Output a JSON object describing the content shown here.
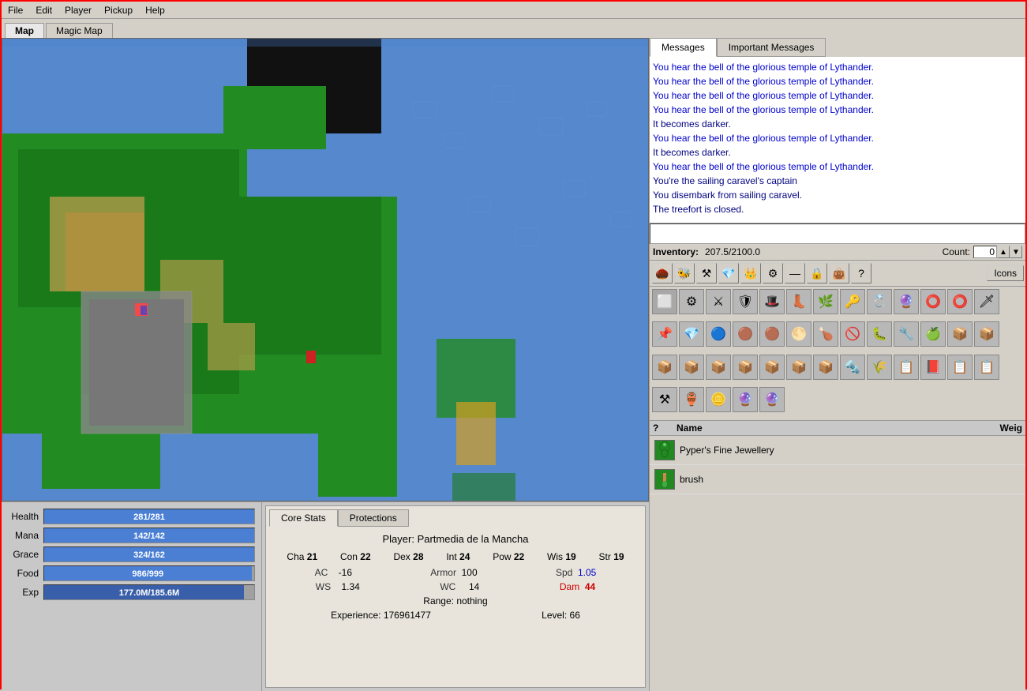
{
  "menu": {
    "items": [
      "File",
      "Edit",
      "Player",
      "Pickup",
      "Help"
    ]
  },
  "map_tabs": [
    {
      "label": "Map",
      "active": true
    },
    {
      "label": "Magic Map",
      "active": false
    }
  ],
  "messages": {
    "tabs": [
      {
        "label": "Messages",
        "active": true
      },
      {
        "label": "Important Messages",
        "active": false
      }
    ],
    "lines": [
      "You hear the bell of the glorious temple of Lythander.",
      "You hear the bell of the glorious temple of Lythander.",
      "You hear the bell of the glorious temple of Lythander.",
      "You hear the bell of the glorious temple of Lythander.",
      "It becomes darker.",
      "You hear the bell of the glorious temple of Lythander.",
      "It becomes darker.",
      "You hear the bell of the glorious temple of Lythander.",
      "You're the sailing caravel's captain",
      "You disembark from sailing caravel.",
      "The treefort is closed."
    ]
  },
  "inventory": {
    "label": "Inventory:",
    "weight": "207.5/2100.0",
    "count_label": "Count:",
    "count_value": "0",
    "icons_label": "Icons"
  },
  "you_see": {
    "header_q": "?",
    "header_name": "Name",
    "header_weight": "Weig",
    "items": [
      {
        "name": "Pyper's Fine Jewellery",
        "icon": "💎",
        "color": "#228822"
      },
      {
        "name": "brush",
        "icon": "🖌",
        "color": "#228822"
      }
    ]
  },
  "stats": {
    "health_label": "Health",
    "health_current": 281,
    "health_max": 281,
    "health_display": "281/281",
    "mana_label": "Mana",
    "mana_current": 142,
    "mana_max": 142,
    "mana_display": "142/142",
    "grace_label": "Grace",
    "grace_current": 324,
    "grace_max": 162,
    "grace_display": "324/162",
    "food_label": "Food",
    "food_current": 986,
    "food_max": 999,
    "food_display": "986/999",
    "exp_label": "Exp",
    "exp_display": "177.0M/185.6M",
    "exp_pct": 95
  },
  "core_stats": {
    "tab_core": "Core Stats",
    "tab_protections": "Protections",
    "player_name": "Player: Partmedia de la Mancha",
    "attributes": [
      {
        "name": "Cha",
        "val": "21"
      },
      {
        "name": "Con",
        "val": "22"
      },
      {
        "name": "Dex",
        "val": "28"
      },
      {
        "name": "Int",
        "val": "24"
      },
      {
        "name": "Pow",
        "val": "22"
      },
      {
        "name": "Wis",
        "val": "19"
      },
      {
        "name": "Str",
        "val": "19"
      }
    ],
    "ac_label": "AC",
    "ac_val": "-16",
    "armor_label": "Armor",
    "armor_val": "100",
    "spd_label": "Spd",
    "spd_val": "1.05",
    "ws_label": "WS",
    "ws_val": "1.34",
    "wc_label": "WC",
    "wc_val": "14",
    "dam_label": "Dam",
    "dam_val": "44",
    "range_text": "Range: nothing",
    "exp_label": "Experience:",
    "exp_val": "176961477",
    "level_label": "Level:",
    "level_val": "66"
  }
}
